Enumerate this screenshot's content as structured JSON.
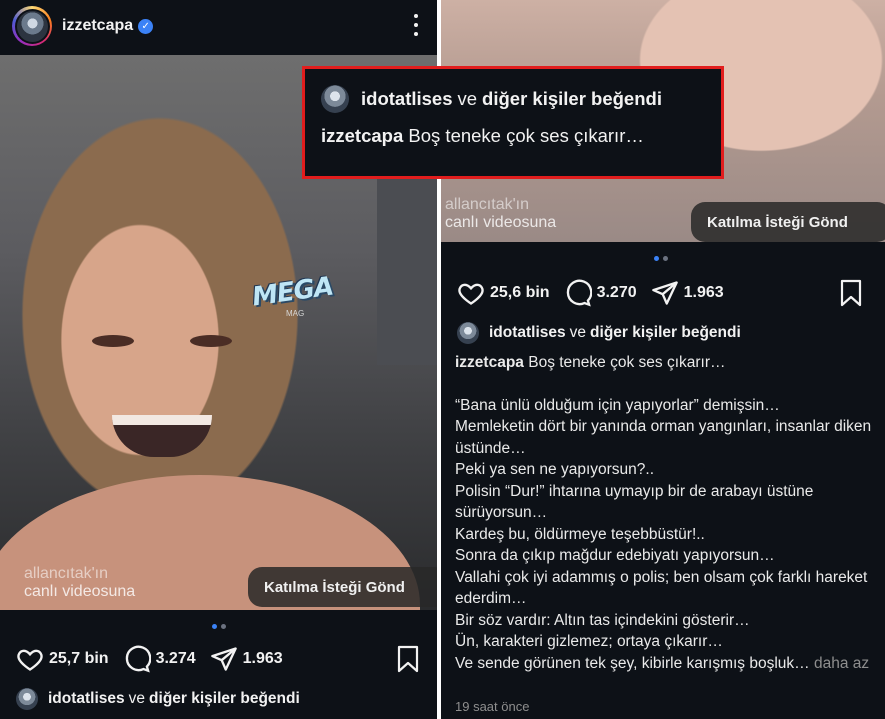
{
  "left_post": {
    "username": "izzetcapa",
    "verified": true,
    "watermark_brand": "MEGA",
    "watermark_sub": "MAG",
    "live_caption_line1": "allancıtak'ın",
    "live_caption_line2": "canlı videosuna",
    "join_button": "Katılma İsteği Gönd",
    "carousel": {
      "count": 2,
      "active_index": 0
    },
    "likes": "25,7 bin",
    "comments": "3.274",
    "shares": "1.963",
    "liked_by_user": "idotatlises",
    "liked_by_connector": "ve",
    "liked_by_others": "diğer kişiler beğendi"
  },
  "right_post": {
    "live_caption_line1": "allancıtak'ın",
    "live_caption_line2": "canlı videosuna",
    "join_button": "Katılma İsteği Gönd",
    "carousel": {
      "count": 2,
      "active_index": 0
    },
    "likes": "25,6 bin",
    "comments": "3.270",
    "shares": "1.963",
    "liked_by_user": "idotatlises",
    "liked_by_connector": "ve",
    "liked_by_others": "diğer kişiler beğendi",
    "caption_username": "izzetcapa",
    "caption_first": "Boş teneke çok ses çıkarır…",
    "caption_lines": [
      "“Bana ünlü olduğum için yapıyorlar” demişsin…",
      "Memleketin dört bir yanında orman yangınları, insanlar diken üstünde…",
      "Peki ya sen ne yapıyorsun?..",
      "Polisin “Dur!” ihtarına uymayıp bir de arabayı üstüne sürüyorsun…",
      "Kardeş bu, öldürmeye teşebbüstür!..",
      "Sonra da çıkıp mağdur edebiyatı yapıyorsun…",
      "Vallahi çok iyi adammış o polis; ben olsam çok farklı hareket ederdim…",
      "Bir söz vardır: Altın tas içindekini gösterir…",
      "Ün, karakteri gizlemez; ortaya çıkarır…"
    ],
    "caption_last": "Ve sende görünen tek şey, kibirle karışmış boşluk…",
    "more_label": "daha az",
    "timestamp": "19 saat önce"
  },
  "callout": {
    "liked_by_user": "idotatlises",
    "liked_by_connector": "ve",
    "liked_by_others": "diğer kişiler beğendi",
    "username": "izzetcapa",
    "text": "Boş teneke çok ses çıkarır…",
    "border_color": "#e11d1d"
  },
  "colors": {
    "background": "#0d1117",
    "verified": "#3b82f6",
    "active_dot": "#3b82f6",
    "muted": "#8e8e8e"
  }
}
